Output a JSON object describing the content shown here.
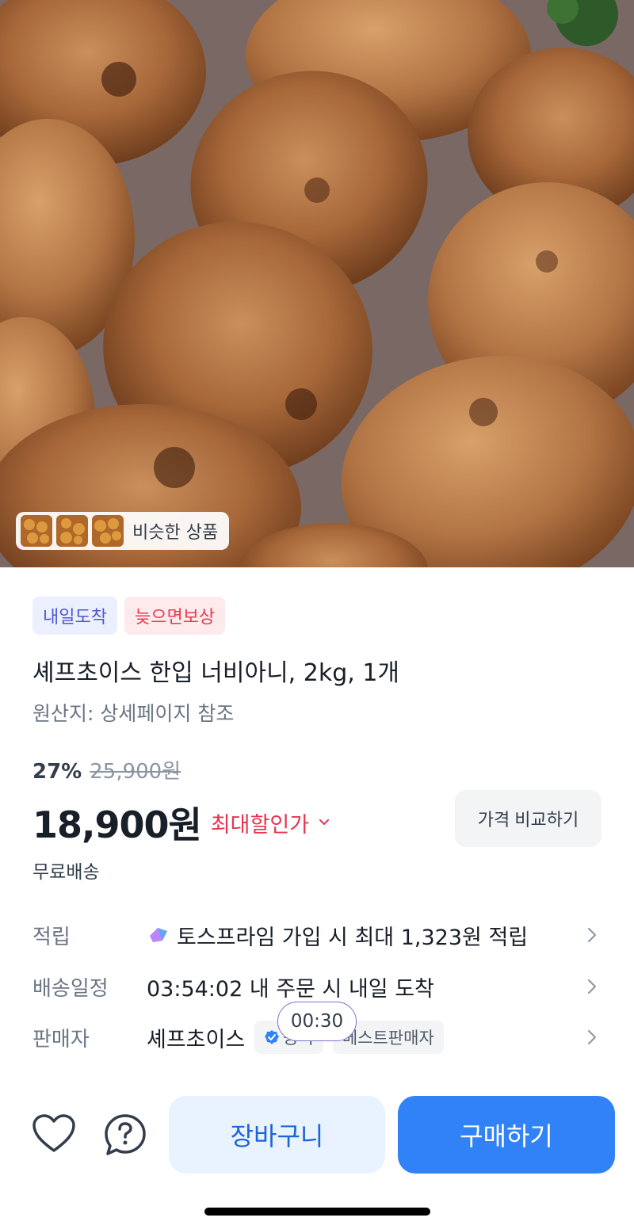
{
  "hero": {
    "image_description_icon": "grilled-meat-patties-photo",
    "similar_products_label": "비슷한 상품"
  },
  "badges": {
    "arrival": "내일도착",
    "late_compensation": "늦으면보상"
  },
  "product": {
    "title": "셰프초이스 한입 너비아니, 2kg, 1개",
    "origin": "원산지: 상세페이지 참조",
    "discount_rate": "27%",
    "original_price": "25,900원",
    "price": "18,900원",
    "max_discount_label": "최대할인가",
    "compare_button": "가격 비교하기",
    "shipping": "무료배송"
  },
  "info": {
    "points_label": "적립",
    "points_value": "토스프라임 가입 시 최대 1,323원 적립",
    "delivery_label": "배송일정",
    "delivery_value": "03:54:02 내 주문 시 내일 도착",
    "seller_label": "판매자",
    "seller_name": "셰프초이스",
    "seller_official": "공식",
    "seller_best": "베스트판매자",
    "timer": "00:30"
  },
  "bottom": {
    "cart_button": "장바구니",
    "buy_button": "구매하기"
  },
  "colors": {
    "primary": "#3182f6",
    "primary_light": "#e8f3ff",
    "discount_red": "#e8344e",
    "badge_blue": "#4b59d4"
  }
}
